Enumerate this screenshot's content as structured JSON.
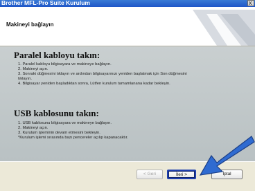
{
  "window": {
    "title": "Brother MFL-Pro Suite Kurulum",
    "close_label": "x"
  },
  "header": {
    "title": "Makineyi bağlayın"
  },
  "sections": [
    {
      "title": "Paralel kabloyu takın:",
      "lines": [
        "1. Paralel kabloyu bilgisayara ve makineye bağlayın.",
        "2. Makineyi açın.",
        "3. Sonraki düğmesini tıklayın ve ardından bilgisayarınızı yeniden başlatmak için Son düğmesini",
        "tıklayın.",
        "4. Bilgisayar yeniden başladıktan sonra, Lütfen kurulum tamamlanana kadar bekleyin."
      ]
    },
    {
      "title": "USB kablosunu takın:",
      "lines": [
        "1. USB kablosunu bilgisayara ve makineye bağlayın.",
        "2. Makineyi açın.",
        "3. Kurulum işleminin devam etmesini bekleyin.",
        "*Kurulum işlemi sırasında bazı pencereler açılıp kapanacaktır."
      ]
    }
  ],
  "buttons": {
    "back": "< Geri",
    "next": "İleri >",
    "cancel": "İptal"
  },
  "colors": {
    "titlebar": "#1f56c8",
    "content_bg": "#c9cfd0",
    "arrow": "#2f6bd1"
  }
}
